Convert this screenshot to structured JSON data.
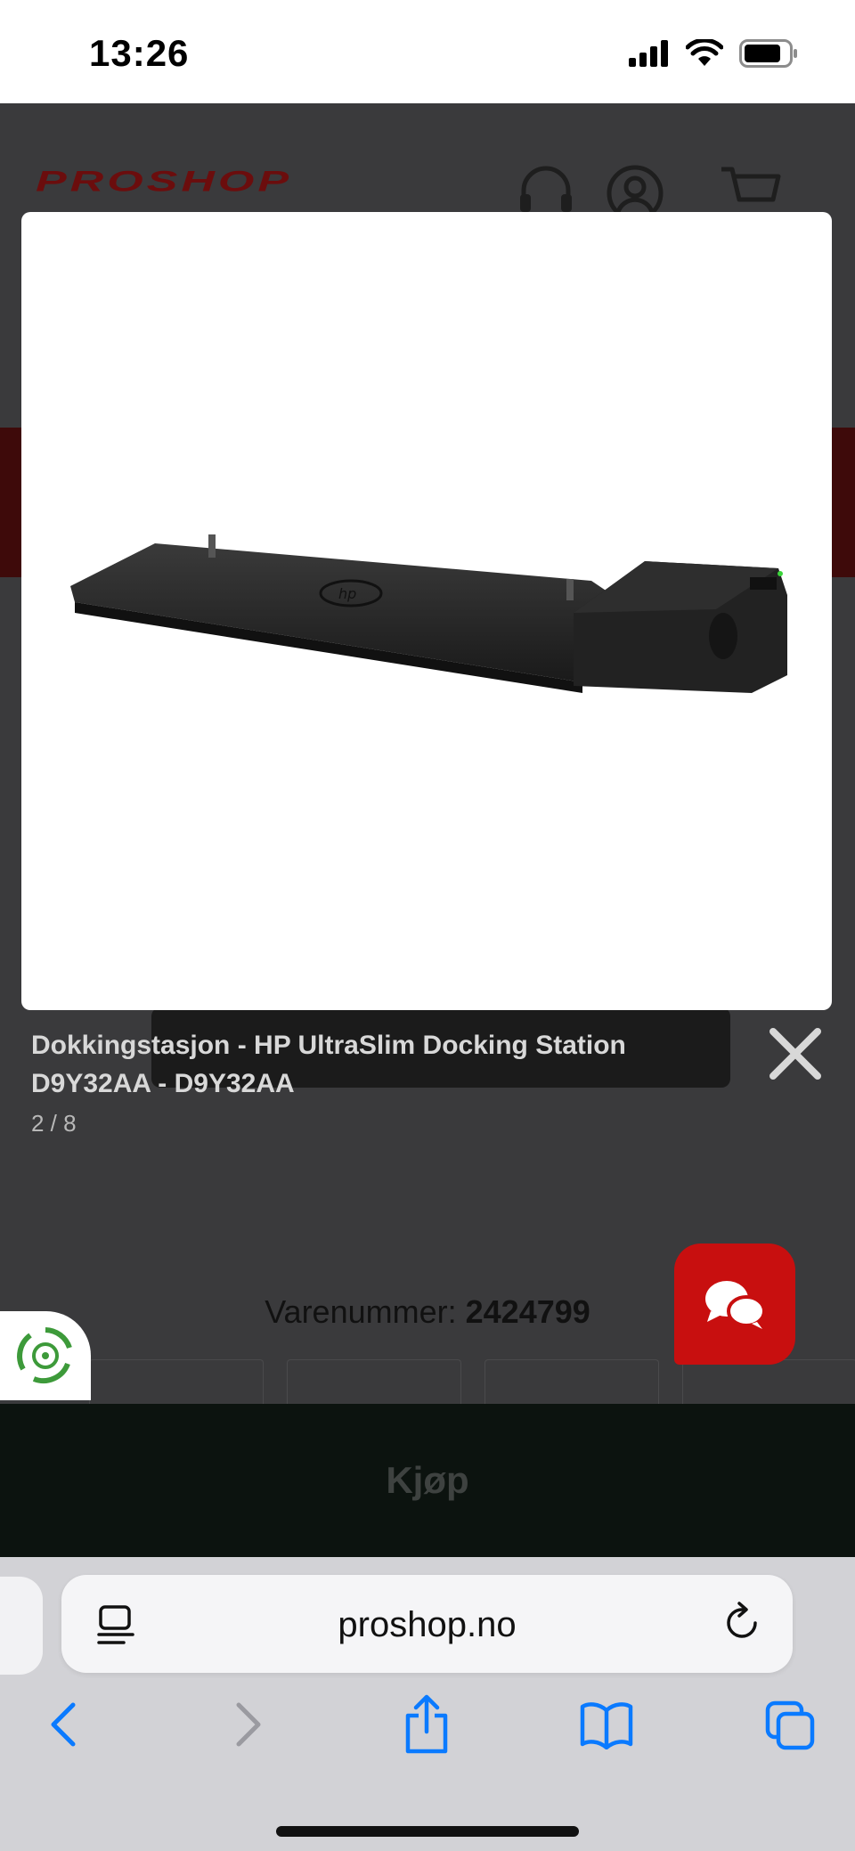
{
  "status_bar": {
    "time": "13:26"
  },
  "site": {
    "logo": "PROSHOP",
    "varenummer_label": "Varenummer:",
    "varenummer_value": "2424799",
    "buy_label": "Kjøp"
  },
  "lightbox": {
    "title": "Dokkingstasjon - HP UltraSlim Docking Station D9Y32AA - D9Y32AA",
    "counter": "2 / 8"
  },
  "browser": {
    "url": "proshop.no"
  },
  "colors": {
    "brand_red": "#c80f0f",
    "safari_blue": "#0a7aff",
    "overlay": "#3a3a3c"
  }
}
